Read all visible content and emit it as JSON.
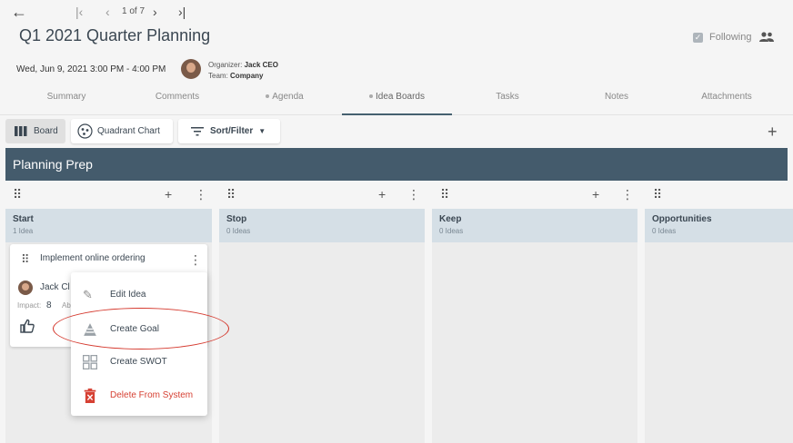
{
  "nav": {
    "back_icon": "arrow-left-icon",
    "pagination_text": "1 of 7"
  },
  "meeting": {
    "title": "Q1 2021 Quarter Planning",
    "following_label": "Following",
    "date_time": "Wed, Jun 9, 2021 3:00 PM - 4:00 PM",
    "organizer_label": "Organizer:",
    "organizer_name": "Jack CEO",
    "team_label": "Team:",
    "team_name": "Company"
  },
  "tabs": [
    "Summary",
    "Comments",
    "Agenda",
    "Idea Boards",
    "Tasks",
    "Notes",
    "Attachments"
  ],
  "toolbar": {
    "board_label": "Board",
    "quadrant_label": "Quadrant Chart",
    "sort_label": "Sort/Filter"
  },
  "board": {
    "title": "Planning Prep",
    "columns": [
      {
        "name": "Start",
        "count": "1 Idea"
      },
      {
        "name": "Stop",
        "count": "0 Ideas"
      },
      {
        "name": "Keep",
        "count": "0 Ideas"
      },
      {
        "name": "Opportunities",
        "count": "0 Ideas"
      }
    ]
  },
  "card": {
    "title": "Implement online ordering",
    "author": "Jack Cl",
    "impact_label": "Impact:",
    "impact_value": "8",
    "other_label": "Ab"
  },
  "context_menu": {
    "edit": "Edit Idea",
    "goal": "Create Goal",
    "swot": "Create SWOT",
    "delete": "Delete From System"
  },
  "colors": {
    "banner": "#445b6c",
    "column_header": "#d5dfe6",
    "danger": "#d64033",
    "highlight_ellipse": "#d53a2f"
  }
}
